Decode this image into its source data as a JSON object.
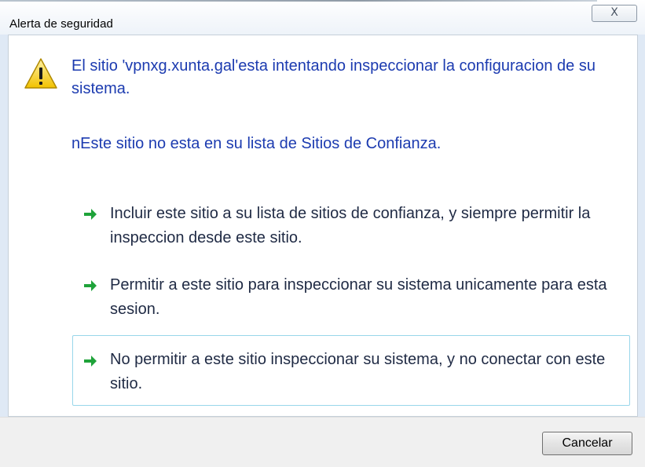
{
  "window": {
    "title": "Alerta de seguridad",
    "close_label": "X"
  },
  "message": {
    "line1": "El sitio 'vpnxg.xunta.gal'esta intentando inspeccionar la configuracion de su sistema.",
    "line2": "nEste sitio no esta en su lista de Sitios de Confianza."
  },
  "options": [
    {
      "text": "Incluir este sitio a su lista de sitios de confianza, y siempre permitir la inspeccion desde este sitio."
    },
    {
      "text": "Permitir a este sitio para inspeccionar su sistema unicamente para esta sesion."
    },
    {
      "text": "No permitir a este sitio inspeccionar su sistema, y no conectar con este sitio."
    }
  ],
  "footer": {
    "cancel_label": "Cancelar"
  },
  "icons": {
    "warning": "warning-icon",
    "option_arrow": "green-arrow-icon",
    "close": "close-icon"
  },
  "colors": {
    "message_text": "#1c3bb0",
    "option_text": "#1f2a44",
    "arrow_green": "#1fa33a",
    "selection_border": "#98d6ea"
  }
}
